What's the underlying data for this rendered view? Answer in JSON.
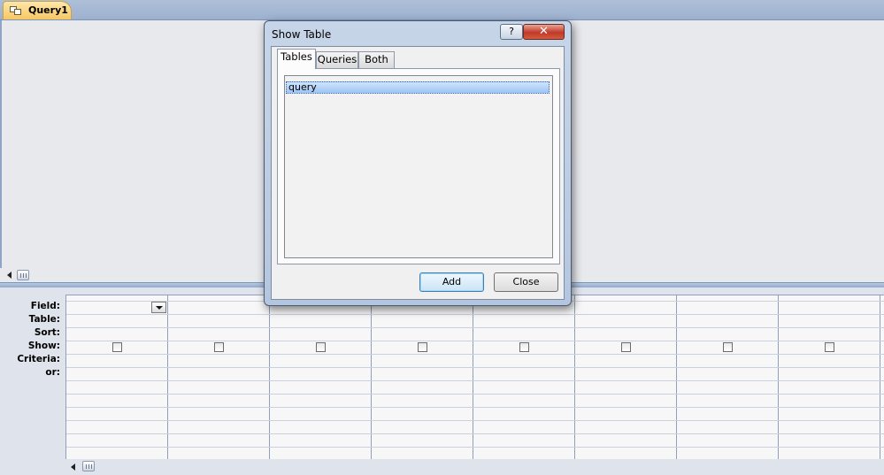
{
  "document_tab": {
    "label": "Query1",
    "icon": "query-icon"
  },
  "grid": {
    "row_labels": [
      "Field:",
      "Table:",
      "Sort:",
      "Show:",
      "Criteria:",
      "or:"
    ],
    "column_count": 8,
    "field_dropdown_icon": "chevron-down-icon"
  },
  "dialog": {
    "title": "Show Table",
    "help_label": "?",
    "close_label": "✕",
    "tabs": [
      {
        "label": "Tables",
        "active": true
      },
      {
        "label": "Queries",
        "active": false
      },
      {
        "label": "Both",
        "active": false
      }
    ],
    "list_items": [
      {
        "label": "query",
        "selected": true
      }
    ],
    "buttons": {
      "add_label": "Add",
      "close_label": "Close"
    }
  },
  "colors": {
    "accent_tab": "#f6c764",
    "selection": "#9ec4f3",
    "close_button": "#c2382a",
    "frame": "#b4c6df"
  }
}
